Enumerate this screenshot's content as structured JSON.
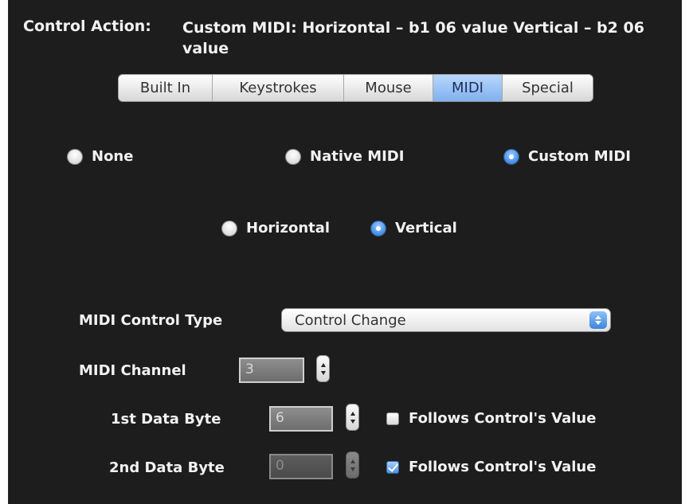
{
  "header": {
    "label": "Control Action:",
    "value": "Custom MIDI: Horizontal – b1 06 value Vertical – b2 06 value"
  },
  "tabs": [
    {
      "label": "Built In",
      "selected": false
    },
    {
      "label": "Keystrokes",
      "selected": false
    },
    {
      "label": "Mouse",
      "selected": false
    },
    {
      "label": "MIDI",
      "selected": true
    },
    {
      "label": "Special",
      "selected": false
    }
  ],
  "midi_mode": {
    "options": [
      {
        "label": "None",
        "selected": false
      },
      {
        "label": "Native MIDI",
        "selected": false
      },
      {
        "label": "Custom MIDI",
        "selected": true
      }
    ]
  },
  "orientation": {
    "options": [
      {
        "label": "Horizontal",
        "selected": false
      },
      {
        "label": "Vertical",
        "selected": true
      }
    ]
  },
  "control_type": {
    "label": "MIDI Control Type",
    "value": "Control Change"
  },
  "channel": {
    "label": "MIDI Channel",
    "value": "3"
  },
  "data_byte_1": {
    "label": "1st Data Byte",
    "value": "6",
    "follows_label": "Follows Control's Value",
    "follows_checked": false
  },
  "data_byte_2": {
    "label": "2nd Data Byte",
    "value": "0",
    "follows_label": "Follows Control's Value",
    "follows_checked": true
  },
  "colors": {
    "panel_background": "#1d1d1d",
    "accent_blue": "#4a92e4",
    "text": "#f2f2f2"
  }
}
